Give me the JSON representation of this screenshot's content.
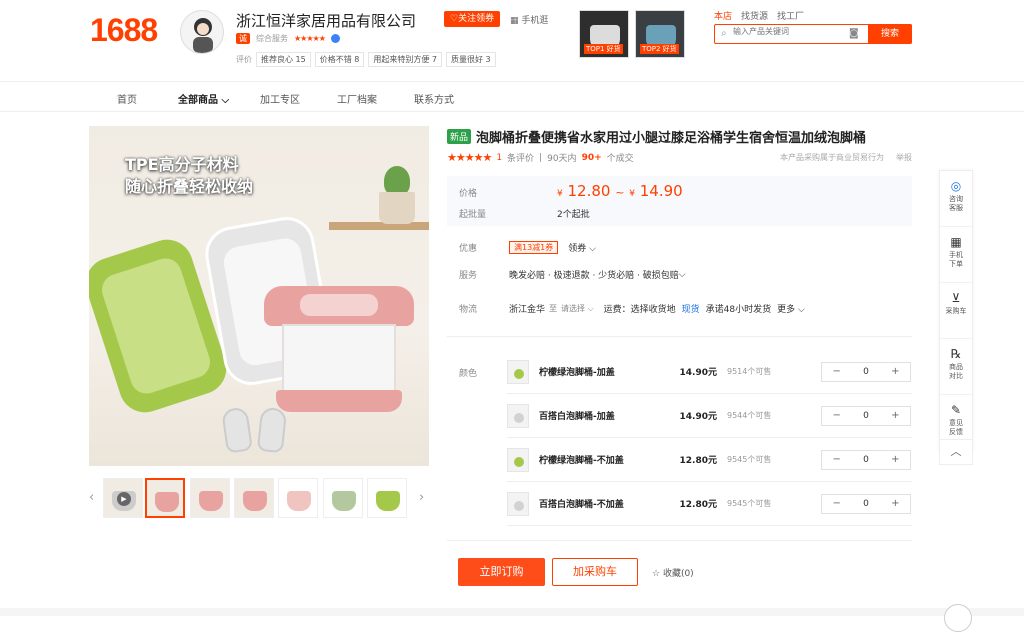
{
  "header": {
    "logo": "1688",
    "shop_name": "浙江恒洋家居用品有限公司",
    "follow_label": "♡关注领券",
    "mobile_label": "手机逛",
    "badge_label": "诚",
    "composite_label": "综合服务",
    "composite_stars": "★★★★★",
    "review_label": "评价",
    "review_tags": [
      "推荐良心 15",
      "价格不错 8",
      "用起来特别方便 7",
      "质量很好 3"
    ],
    "top_thumbs": [
      "TOP1 好货",
      "TOP2 好货"
    ],
    "search_tabs": [
      "本店",
      "找货源",
      "找工厂"
    ],
    "search_placeholder": "输入产品关键词",
    "search_button": "搜索"
  },
  "nav": {
    "items": [
      "首页",
      "全部商品",
      "加工专区",
      "工厂档案",
      "联系方式"
    ]
  },
  "gallery": {
    "headline_1": "TPE高分子材料",
    "headline_2": "随心折叠轻松收纳"
  },
  "product": {
    "new_badge": "新品",
    "title": "泡脚桶折叠便携省水家用过小腿过膝足浴桶学生宿舍恒温加绒泡脚桶",
    "stars": "★★★★★",
    "review_count": "1",
    "review_suffix": "条评价",
    "sold_prefix": "90天内",
    "sold_count": "90+",
    "sold_suffix": "个成交",
    "notice": "本产品采购属于商业贸易行为",
    "report": "举报",
    "price_label": "价格",
    "price_low": "12.80",
    "price_sep": "~",
    "price_high": "14.90",
    "currency": "¥",
    "moq_label": "起批量",
    "moq_value": "2个起批",
    "promo_label": "优惠",
    "coupon_text": "满13减1券",
    "coupon_link": "领券",
    "service_label": "服务",
    "service_text": "晚发必赔 · 极速退款 · 少货必赔 · 破损包赔",
    "logistics_label": "物流",
    "origin": "浙江金华",
    "to": "至",
    "dest_placeholder": "请选择",
    "freight": "运费：选择收货地",
    "stock_tag": "现货",
    "ship_promise": "承诺48小时发货",
    "more": "更多"
  },
  "sku": {
    "label": "颜色",
    "rows": [
      {
        "name": "柠檬绿泡脚桶-加盖",
        "price": "14.90元",
        "stock": "9514个可售",
        "qty": "0",
        "color": "#a4c94a"
      },
      {
        "name": "百搭白泡脚桶-加盖",
        "price": "14.90元",
        "stock": "9544个可售",
        "qty": "0",
        "color": "#dcdcdc"
      },
      {
        "name": "柠檬绿泡脚桶-不加盖",
        "price": "12.80元",
        "stock": "9545个可售",
        "qty": "0",
        "color": "#a4c94a"
      },
      {
        "name": "百搭白泡脚桶-不加盖",
        "price": "12.80元",
        "stock": "9545个可售",
        "qty": "0",
        "color": "#dcdcdc"
      }
    ]
  },
  "actions": {
    "order": "立即订购",
    "cart": "加采购车",
    "favorite": "收藏(0)"
  },
  "sidebar": {
    "items": [
      "咨询\n客服",
      "手机\n下单",
      "采购车",
      "商品\n对比",
      "意见\n反馈"
    ]
  },
  "colors": {
    "brand": "#ff4000",
    "green": "#a4c94a",
    "pink": "#e8a3a0"
  }
}
